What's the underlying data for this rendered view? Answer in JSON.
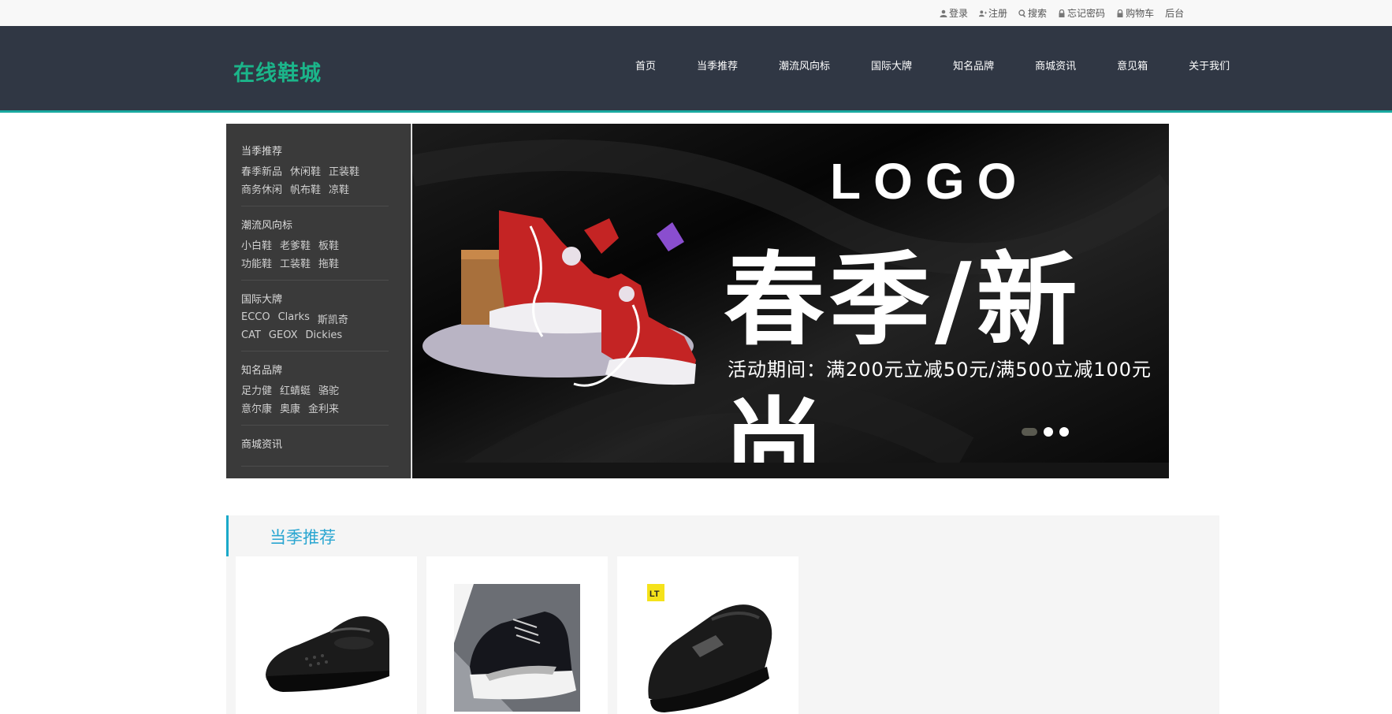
{
  "topbar": {
    "links": [
      {
        "label": "登录",
        "icon": "user-icon"
      },
      {
        "label": "注册",
        "icon": "user-add-icon"
      },
      {
        "label": "搜索",
        "icon": "search-icon"
      },
      {
        "label": "忘记密码",
        "icon": "lock-icon"
      },
      {
        "label": "购物车",
        "icon": "lock-icon"
      },
      {
        "label": "后台",
        "icon": ""
      }
    ]
  },
  "header": {
    "logo": "在线鞋城",
    "nav": [
      "首页",
      "当季推荐",
      "潮流风向标",
      "国际大牌",
      "知名品牌",
      "商城资讯",
      "意见箱",
      "关于我们"
    ]
  },
  "sidebar": {
    "groups": [
      {
        "title": "当季推荐",
        "links": [
          "春季新品",
          "休闲鞋",
          "正装鞋",
          "商务休闲",
          "帆布鞋",
          "凉鞋"
        ]
      },
      {
        "title": "潮流风向标",
        "links": [
          "小白鞋",
          "老爹鞋",
          "板鞋",
          "功能鞋",
          "工装鞋",
          "拖鞋"
        ]
      },
      {
        "title": "国际大牌",
        "links": [
          "ECCO",
          "Clarks",
          "斯凯奇",
          "CAT",
          "GEOX",
          "Dickies"
        ]
      },
      {
        "title": "知名品牌",
        "links": [
          "足力健",
          "红蜻蜓",
          "骆驼",
          "意尔康",
          "奥康",
          "金利来"
        ]
      },
      {
        "title": "商城资讯",
        "links": []
      }
    ]
  },
  "banner": {
    "logo_text": "LOGO",
    "headline": "春季/新尚",
    "subtext": "活动期间：满200元立减50元/满500立减100元",
    "slides": 3,
    "active_slide": 1
  },
  "section": {
    "title": "当季推荐",
    "accent_color": "#1aa9c9",
    "products": [
      {
        "image": "black-leather-loafer"
      },
      {
        "image": "black-sneaker"
      },
      {
        "image": "black-slip-on-shoe"
      }
    ]
  },
  "colors": {
    "header_bg": "#303744",
    "logo": "#1bb58a",
    "header_border": "#1aa9a0",
    "sidebar_bg": "#3a3a3a"
  }
}
